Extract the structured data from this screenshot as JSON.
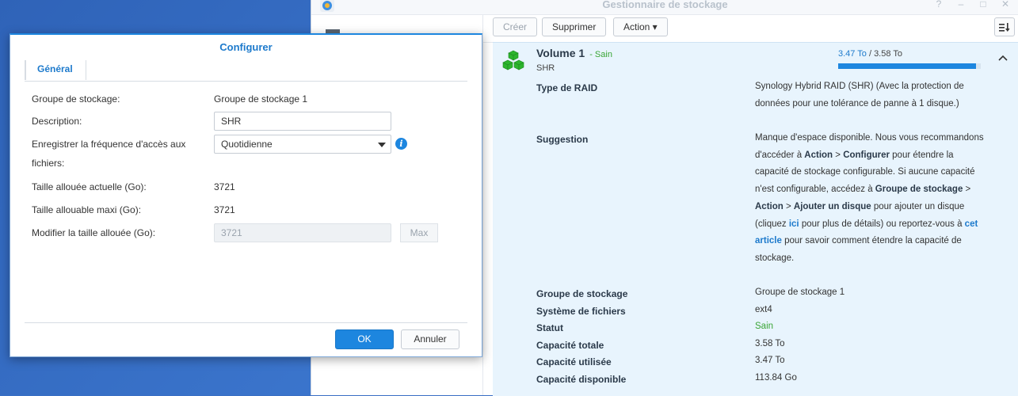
{
  "app": {
    "title": "Gestionnaire de stockage",
    "logo_icon": "storage-manager-logo",
    "window_controls": [
      "?",
      "–",
      "□",
      "✕"
    ]
  },
  "toolbar": {
    "create_label": "Créer",
    "delete_label": "Supprimer",
    "action_label": "Action ▾",
    "sort_icon": "sort-icon"
  },
  "volume": {
    "name": "Volume 1",
    "status_inline": "- Sain",
    "type": "SHR",
    "usage_used": "3.47 To",
    "usage_sep": " / ",
    "usage_total": "3.58 To",
    "usage_fraction": 0.969,
    "details": {
      "raid_label": "Type de RAID",
      "raid_value": "Synology Hybrid RAID (SHR) (Avec la protection de données pour une tolérance de panne à 1 disque.)",
      "suggestion_label": "Suggestion",
      "suggestion_parts": {
        "p1": "Manque d'espace disponible. Nous vous recommandons d'accéder à ",
        "b1": "Action",
        "p2": " > ",
        "b2": "Configurer",
        "p3": " pour étendre la capacité de stockage configurable. Si aucune capacité n'est configurable, accédez à ",
        "b3": "Groupe de stockage",
        "p4": " > ",
        "b4": "Action",
        "p5": " > ",
        "b5": "Ajouter un disque",
        "p6": " pour ajouter un disque (cliquez ",
        "link1": "ici",
        "p7": " pour plus de détails) ou reportez-vous à ",
        "link2": "cet article",
        "p8": " pour savoir comment étendre la capacité de stockage."
      },
      "pool_label": "Groupe de stockage",
      "pool_value": "Groupe de stockage 1",
      "fs_label": "Système de fichiers",
      "fs_value": "ext4",
      "status_label": "Statut",
      "status_value": "Sain",
      "total_label": "Capacité totale",
      "total_value": "3.58 To",
      "used_label": "Capacité utilisée",
      "used_value": "3.47 To",
      "free_label": "Capacité disponible",
      "free_value": "113.84 Go"
    }
  },
  "dialog": {
    "title": "Configurer",
    "tab_general": "Général",
    "pool_label": "Groupe de stockage:",
    "pool_value": "Groupe de stockage 1",
    "description_label": "Description:",
    "description_value": "SHR",
    "freq_label": "Enregistrer la fréquence d'accès aux fichiers:",
    "freq_value": "Quotidienne",
    "current_size_label": "Taille allouée actuelle (Go):",
    "current_size_value": "3721",
    "max_size_label": "Taille allouable maxi (Go):",
    "max_size_value": "3721",
    "modify_label": "Modifier la taille allouée (Go):",
    "modify_value": "3721",
    "max_button": "Max",
    "ok": "OK",
    "cancel": "Annuler"
  },
  "colors": {
    "accent": "#1d86df",
    "status_ok": "#3aa535",
    "panel_bg": "#e8f4fd"
  }
}
